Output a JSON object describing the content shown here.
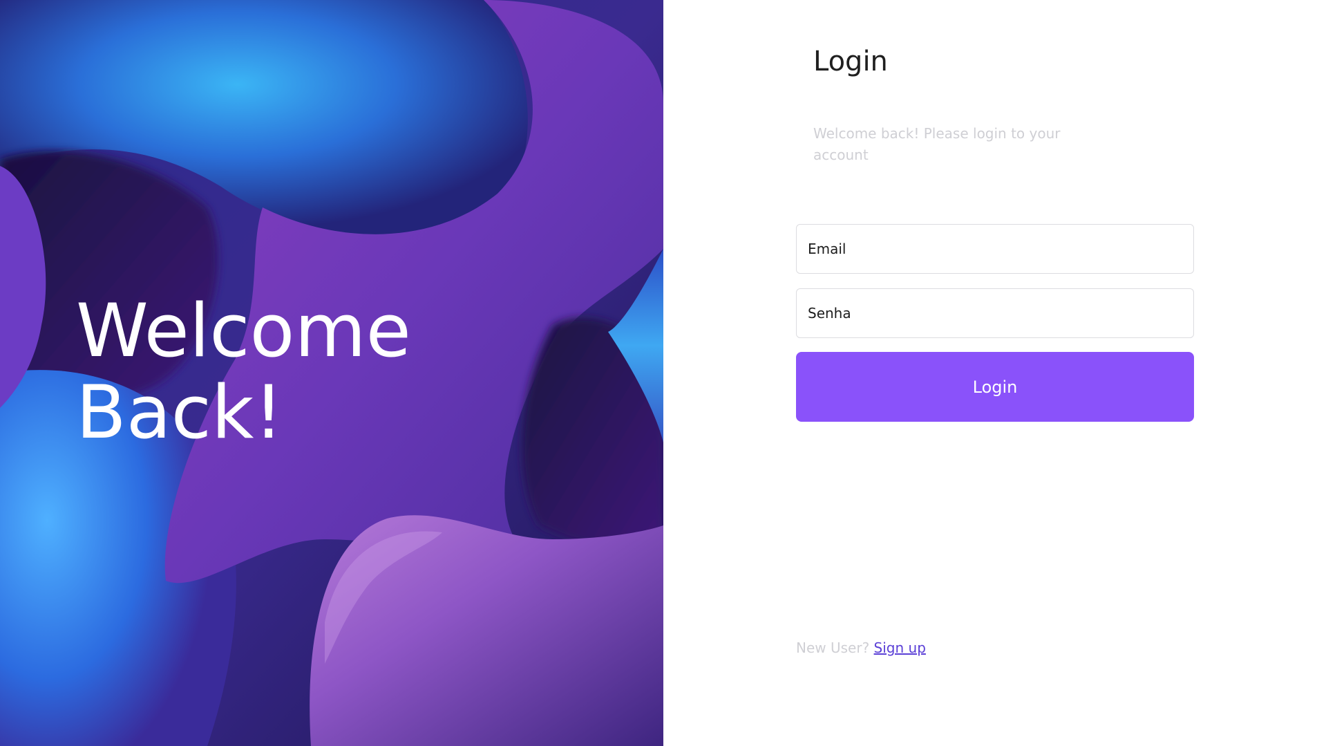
{
  "hero": {
    "title_line1": "Welcome",
    "title_line2": "Back!"
  },
  "form": {
    "heading": "Login",
    "subtitle": "Welcome back! Please login to your account",
    "email_placeholder": "Email",
    "password_placeholder": "Senha",
    "login_button_label": "Login",
    "signup_prompt": "New User?",
    "signup_link_label": "Sign up"
  },
  "colors": {
    "accent": "#8a52fa",
    "link": "#5a3fd6",
    "muted_text": "#cfcfd4",
    "heading_text": "#1f1f1f"
  }
}
